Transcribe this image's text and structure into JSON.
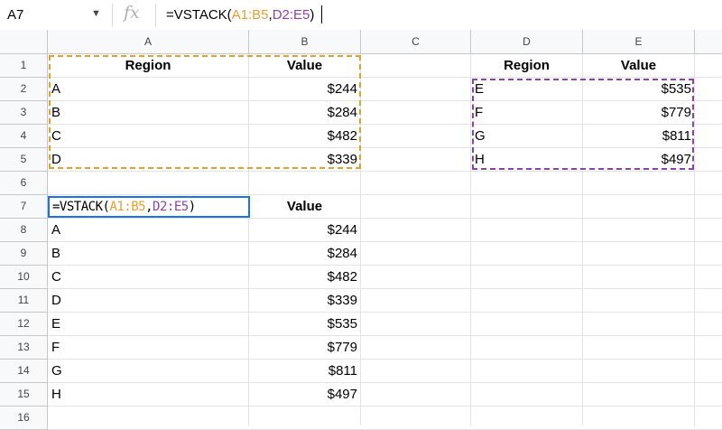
{
  "name_box": {
    "value": "A7"
  },
  "formula_bar": {
    "fx_label": "fx",
    "parts": [
      {
        "text": "=VSTACK(",
        "color": "#000000"
      },
      {
        "text": "A1:B5",
        "color": "#e69f2b"
      },
      {
        "text": ",",
        "color": "#000000"
      },
      {
        "text": "D2:E5",
        "color": "#8e3fb2"
      },
      {
        "text": ")",
        "color": "#000000"
      }
    ]
  },
  "columns": [
    "A",
    "B",
    "C",
    "D",
    "E"
  ],
  "rows": [
    "1",
    "2",
    "3",
    "4",
    "5",
    "6",
    "7",
    "8",
    "9",
    "10",
    "11",
    "12",
    "13",
    "14",
    "15",
    "16"
  ],
  "source_a": {
    "headers": [
      "Region",
      "Value"
    ],
    "rows": [
      [
        "A",
        "$244"
      ],
      [
        "B",
        "$284"
      ],
      [
        "C",
        "$482"
      ],
      [
        "D",
        "$339"
      ]
    ]
  },
  "source_d": {
    "headers": [
      "Region",
      "Value"
    ],
    "rows": [
      [
        "E",
        "$535"
      ],
      [
        "F",
        "$779"
      ],
      [
        "G",
        "$811"
      ],
      [
        "H",
        "$497"
      ]
    ]
  },
  "result": {
    "header_value": "Value",
    "rows": [
      [
        "A",
        "$244"
      ],
      [
        "B",
        "$284"
      ],
      [
        "C",
        "$482"
      ],
      [
        "D",
        "$339"
      ],
      [
        "E",
        "$535"
      ],
      [
        "F",
        "$779"
      ],
      [
        "G",
        "$811"
      ],
      [
        "H",
        "$497"
      ]
    ]
  },
  "colors": {
    "range_a": "#e69f2b",
    "range_d": "#8e3fb2",
    "active": "#1a73e8"
  }
}
